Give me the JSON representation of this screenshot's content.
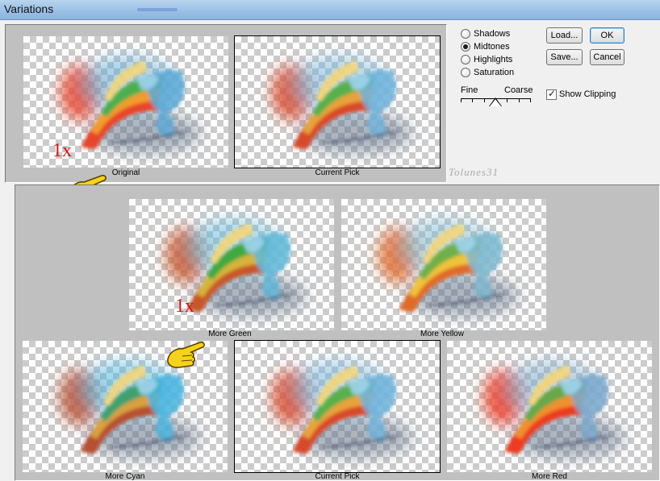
{
  "window": {
    "title": "Variations"
  },
  "thumbnails": {
    "original": "Original",
    "current_pick_top": "Current Pick",
    "more_green": "More Green",
    "more_yellow": "More Yellow",
    "more_cyan": "More Cyan",
    "current_pick_center": "Current Pick",
    "more_red": "More Red"
  },
  "annotations": {
    "step_top": "1x",
    "step_bottom": "1x",
    "watermark": "Tolunes31"
  },
  "tones": {
    "options": [
      "Shadows",
      "Midtones",
      "Highlights",
      "Saturation"
    ],
    "selected": "Midtones"
  },
  "buttons": {
    "load": "Load...",
    "save": "Save...",
    "ok": "OK",
    "cancel": "Cancel"
  },
  "slider": {
    "fine_label": "Fine",
    "coarse_label": "Coarse",
    "tick_count": 7,
    "position": 0.5
  },
  "show_clipping": {
    "label": "Show Clipping",
    "checked": true
  },
  "icons": {
    "pointer": "pointing-hand-icon"
  }
}
